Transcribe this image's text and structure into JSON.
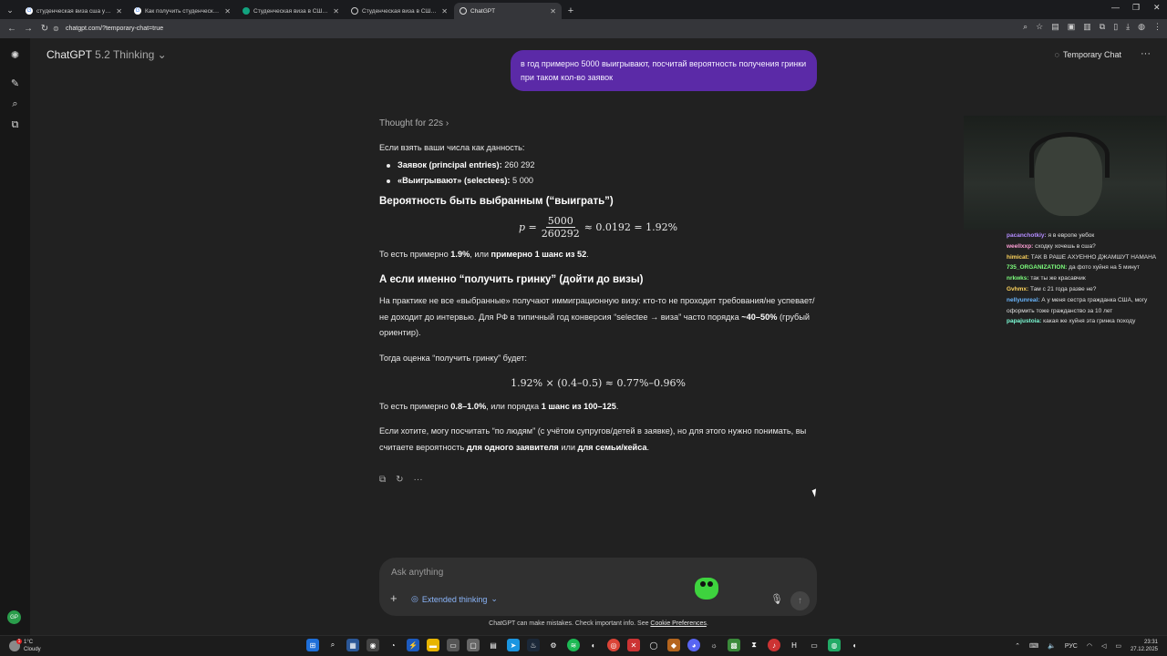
{
  "browser": {
    "tabs": [
      {
        "title": "студенческая виза сша учитс",
        "color": "#4285f4"
      },
      {
        "title": "Как получить студенческую в",
        "color": "#4285f4"
      },
      {
        "title": "Студенческая виза в США - в",
        "color": "#12a37f"
      },
      {
        "title": "Студенческая виза в США сл",
        "color": "#e0e0e0"
      },
      {
        "title": "ChatGPT",
        "color": "#e0e0e0"
      }
    ],
    "active_tab_index": 4,
    "url": "chatgpt.com/?temporary-chat=true"
  },
  "header": {
    "model_name": "ChatGPT",
    "model_version": "5.2 Thinking",
    "temp_chat_label": "Temporary Chat"
  },
  "conversation": {
    "user_message": "в год примерно 5000 выигрывают, посчитай вероятность получения гринки при таком кол-во заявок",
    "thought_label": "Thought for 22s",
    "intro": "Если взять ваши числа как данность:",
    "bullets": [
      {
        "bold": "Заявок (principal entries):",
        "text": " 260 292"
      },
      {
        "bold": "«Выигрывают» (selectees):",
        "text": " 5 000"
      }
    ],
    "h1": "Вероятность быть выбранным (“выиграть”)",
    "eq1": {
      "lhs": "p =",
      "num": "5000",
      "den": "260292",
      "rhs": "≈ 0.0192 = 1.92%"
    },
    "p1": {
      "a": "То есть примерно ",
      "b": "1.9%",
      "c": ", или ",
      "d": "примерно 1 шанс из 52",
      "e": "."
    },
    "h2": "А если именно “получить гринку” (дойти до визы)",
    "p2": {
      "a": "На практике не все «выбранные» получают иммиграционную визу: кто-то не проходит требования/не успевает/не доходит до интервью. Для РФ в типичный год конверсия “selectee → виза” часто порядка ",
      "b": "~40–50%",
      "c": " (грубый ориентир)."
    },
    "p3": "Тогда оценка “получить гринку” будет:",
    "eq2": "1.92% × (0.4–0.5) ≈ 0.77%–0.96%",
    "p4": {
      "a": "То есть примерно ",
      "b": "0.8–1.0%",
      "c": ", или порядка ",
      "d": "1 шанс из 100–125",
      "e": "."
    },
    "p5": {
      "a": "Если хотите, могу посчитать “по людям” (с учётом супругов/детей в заявке), но для этого нужно понимать, вы считаете вероятность ",
      "b": "для одного заявителя",
      "c": " или ",
      "d": "для семьи/кейса",
      "e": "."
    }
  },
  "composer": {
    "placeholder": "Ask anything",
    "mode_label": "Extended thinking"
  },
  "disclaimer": {
    "text": "ChatGPT can make mistakes. Check important info. See ",
    "link": "Cookie Preferences",
    "end": "."
  },
  "stream_chat": [
    {
      "user": "pacanchotkiy:",
      "color": "#b48cff",
      "msg": "я в европе уебок"
    },
    {
      "user": "weellxxp:",
      "color": "#ff9fd6",
      "msg": "сходку хочешь в сша?"
    },
    {
      "user": "himicat:",
      "color": "#ffd45c",
      "msg": "ТАК В РАШЕ АХУЕННО ДЖАМШУТ НАМАНА"
    },
    {
      "user": "735_ORGANIZATION:",
      "color": "#7dff7d",
      "msg": "да фото хуйня на 5 минут"
    },
    {
      "user": "nrkwks:",
      "color": "#7dff7d",
      "msg": "так ты же красавчик"
    },
    {
      "user": "Gvhmx:",
      "color": "#ffd45c",
      "msg": "Там с 21 года разве не?"
    },
    {
      "user": "nellyunreal:",
      "color": "#6ab7ff",
      "msg": "А у меня сестра гражданка США, могу оформить тоже гражданство за 10 лет"
    },
    {
      "user": "papajustoia:",
      "color": "#7dffd8",
      "msg": "какая же хуйня эта гринка походу"
    }
  ],
  "taskbar": {
    "temp": "1°C",
    "weather": "Cloudy",
    "lang": "РУС",
    "time": "23:31",
    "date": "27.12.2025",
    "avatar_initials": "GP"
  }
}
